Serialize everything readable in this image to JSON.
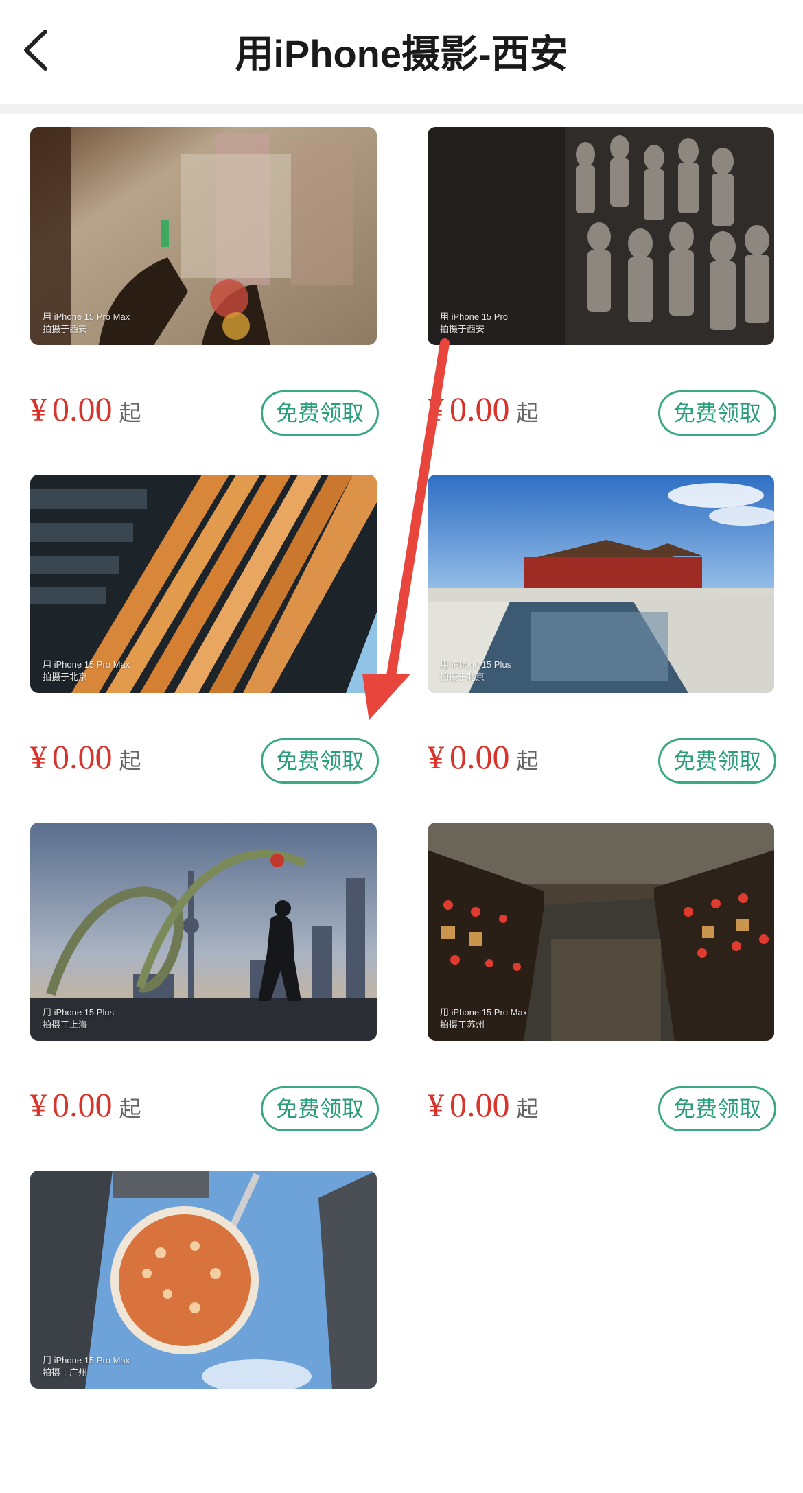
{
  "header": {
    "title": "用iPhone摄影-西安"
  },
  "colors": {
    "price_red": "#d9342b",
    "button_green": "#3aa887",
    "annotation_red": "#e8453c"
  },
  "cards": [
    {
      "caption_device": "用 iPhone 15 Pro Max",
      "caption_place": "拍摄于西安",
      "currency": "¥",
      "price": "0.00",
      "suffix": "起",
      "button": "免费领取"
    },
    {
      "caption_device": "用 iPhone 15 Pro",
      "caption_place": "拍摄于西安",
      "currency": "¥",
      "price": "0.00",
      "suffix": "起",
      "button": "免费领取"
    },
    {
      "caption_device": "用 iPhone 15 Pro Max",
      "caption_place": "拍摄于北京",
      "currency": "¥",
      "price": "0.00",
      "suffix": "起",
      "button": "免费领取"
    },
    {
      "caption_device": "用 iPhone 15 Plus",
      "caption_place": "拍摄于北京",
      "currency": "¥",
      "price": "0.00",
      "suffix": "起",
      "button": "免费领取"
    },
    {
      "caption_device": "用 iPhone 15 Plus",
      "caption_place": "拍摄于上海",
      "currency": "¥",
      "price": "0.00",
      "suffix": "起",
      "button": "免费领取"
    },
    {
      "caption_device": "用 iPhone 15 Pro Max",
      "caption_place": "拍摄于苏州",
      "currency": "¥",
      "price": "0.00",
      "suffix": "起",
      "button": "免费领取"
    },
    {
      "caption_device": "用 iPhone 15 Pro Max",
      "caption_place": "拍摄于广州"
    }
  ]
}
